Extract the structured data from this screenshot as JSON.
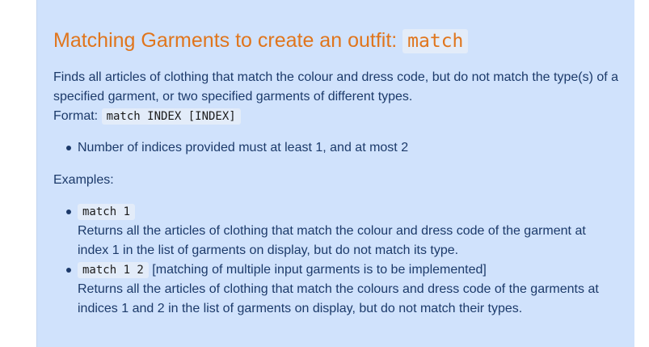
{
  "heading": {
    "text": "Matching Garments to create an outfit: ",
    "code": "match"
  },
  "description": {
    "line1": "Finds all articles of clothing that match the colour and dress code, but do not match the type(s) of a specified garment, or two specified garments of different types.",
    "format_label": "Format: ",
    "format_code": "match INDEX [INDEX]"
  },
  "rules": [
    "Number of indices provided must at least 1, and at most 2"
  ],
  "examples_label": "Examples:",
  "examples": [
    {
      "code": "match 1",
      "note": "",
      "text": "Returns all the articles of clothing that match the colour and dress code of the garment at index 1 in the list of garments on display, but do not match its type."
    },
    {
      "code": "match 1 2",
      "note": " [matching of multiple input garments is to be implemented]",
      "text": "Returns all the articles of clothing that match the colours and dress code of the garments at indices 1 and 2 in the list of garments on display, but do not match their types."
    }
  ]
}
